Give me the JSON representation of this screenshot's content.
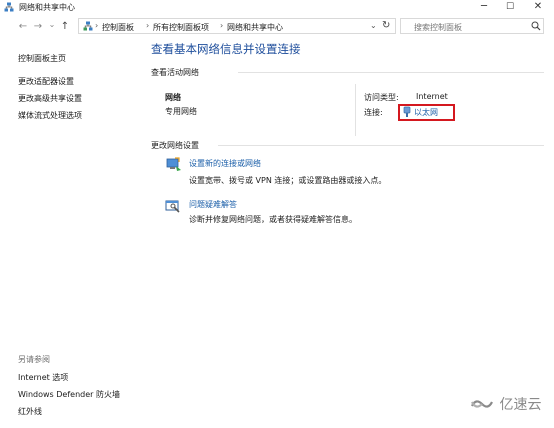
{
  "window": {
    "title": "网络和共享中心",
    "minimize_label": "─",
    "maximize_label": "☐",
    "close_label": "✕"
  },
  "nav": {
    "back": "←",
    "forward": "→",
    "recent": "⌄",
    "up": "↑"
  },
  "address": {
    "separator": "›",
    "crumbs": [
      "控制面板",
      "所有控制面板项",
      "网络和共享中心"
    ],
    "dropdown": "⌄",
    "refresh": "↻"
  },
  "search": {
    "placeholder": "搜索控制面板",
    "icon": "search-icon"
  },
  "sidebar": {
    "home": "控制面板主页",
    "items": [
      "更改适配器设置",
      "更改高级共享设置",
      "媒体流式处理选项"
    ],
    "see_also_heading": "另请参阅",
    "see_also": [
      "Internet 选项",
      "Windows Defender 防火墙",
      "红外线"
    ]
  },
  "main": {
    "title": "查看基本网络信息并设置连接",
    "active_networks_label": "查看活动网络",
    "network": {
      "name": "网络",
      "type": "专用网络",
      "access_type_label": "访问类型:",
      "access_type_value": "Internet",
      "connections_label": "连接:",
      "connection_value": "以太网"
    },
    "change_settings_label": "更改网络设置",
    "tasks": [
      {
        "title": "设置新的连接或网络",
        "description": "设置宽带、拨号或 VPN 连接；或设置路由器或接入点。"
      },
      {
        "title": "问题疑难解答",
        "description": "诊断并修复网络问题，或者获得疑难解答信息。"
      }
    ]
  },
  "watermark": "亿速云",
  "colors": {
    "link": "#1a5ea8",
    "title": "#1e4e9c",
    "highlight": "#d4181f"
  }
}
